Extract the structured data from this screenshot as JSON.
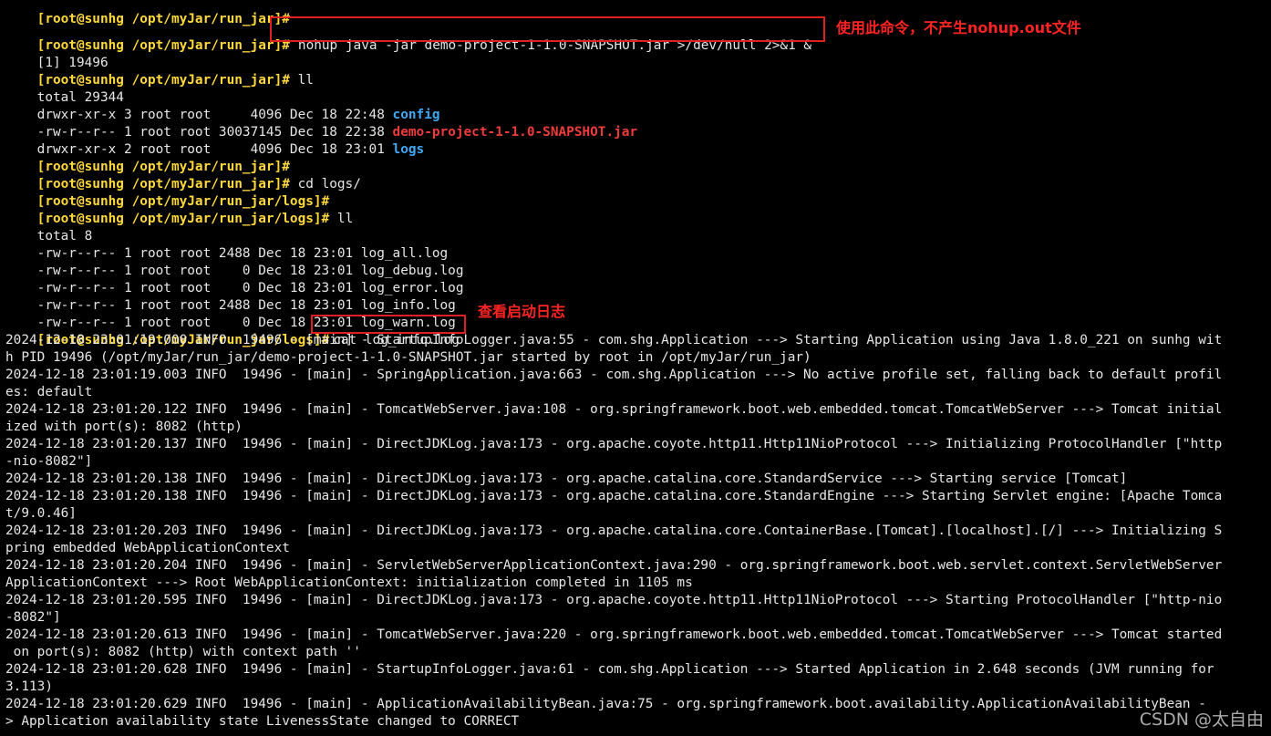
{
  "colors": {
    "background": "#000000",
    "prompt": "#ffd93b",
    "text": "#e6e6e6",
    "directory": "#3fa9f5",
    "jar_file": "#ef3b3b",
    "annotation": "#ff2424"
  },
  "terminal": {
    "prompt_base": "[root@sunhg /opt/myJar/run_jar]#",
    "prompt_logs": "[root@sunhg /opt/myJar/run_jar/logs]#",
    "cmd_nohup": "nohup java -jar demo-project-1-1.0-SNAPSHOT.jar >/dev/null 2>&1 &",
    "job": "[1] 19496",
    "cmd_ll": "ll",
    "total_1": "total 29344",
    "ls1": [
      {
        "perm": "drwxr-xr-x 3 root root     4096 Dec 18 22:48 ",
        "name": "config"
      },
      {
        "perm": "-rw-r--r-- 1 root root 30037145 Dec 18 22:38 ",
        "name": "demo-project-1-1.0-SNAPSHOT.jar"
      },
      {
        "perm": "drwxr-xr-x 2 root root     4096 Dec 18 23:01 ",
        "name": "logs"
      }
    ],
    "cmd_cd": "cd logs/",
    "total_2": "total 8",
    "ls2": [
      "-rw-r--r-- 1 root root 2488 Dec 18 23:01 log_all.log",
      "-rw-r--r-- 1 root root    0 Dec 18 23:01 log_debug.log",
      "-rw-r--r-- 1 root root    0 Dec 18 23:01 log_error.log",
      "-rw-r--r-- 1 root root 2488 Dec 18 23:01 log_info.log",
      "-rw-r--r-- 1 root root    0 Dec 18 23:01 log_warn.log"
    ],
    "cmd_cat": "cat log_info.log",
    "log": [
      "2024-12-18 23:01:19.000 INFO  19496 - [main] - StartupInfoLogger.java:55 - com.shg.Application ---> Starting Application using Java 1.8.0_221 on sunhg wit",
      "h PID 19496 (/opt/myJar/run_jar/demo-project-1-1.0-SNAPSHOT.jar started by root in /opt/myJar/run_jar)",
      "2024-12-18 23:01:19.003 INFO  19496 - [main] - SpringApplication.java:663 - com.shg.Application ---> No active profile set, falling back to default profil",
      "es: default",
      "2024-12-18 23:01:20.122 INFO  19496 - [main] - TomcatWebServer.java:108 - org.springframework.boot.web.embedded.tomcat.TomcatWebServer ---> Tomcat initial",
      "ized with port(s): 8082 (http)",
      "2024-12-18 23:01:20.137 INFO  19496 - [main] - DirectJDKLog.java:173 - org.apache.coyote.http11.Http11NioProtocol ---> Initializing ProtocolHandler [\"http",
      "-nio-8082\"]",
      "2024-12-18 23:01:20.138 INFO  19496 - [main] - DirectJDKLog.java:173 - org.apache.catalina.core.StandardService ---> Starting service [Tomcat]",
      "2024-12-18 23:01:20.138 INFO  19496 - [main] - DirectJDKLog.java:173 - org.apache.catalina.core.StandardEngine ---> Starting Servlet engine: [Apache Tomca",
      "t/9.0.46]",
      "2024-12-18 23:01:20.203 INFO  19496 - [main] - DirectJDKLog.java:173 - org.apache.catalina.core.ContainerBase.[Tomcat].[localhost].[/] ---> Initializing S",
      "pring embedded WebApplicationContext",
      "2024-12-18 23:01:20.204 INFO  19496 - [main] - ServletWebServerApplicationContext.java:290 - org.springframework.boot.web.servlet.context.ServletWebServer",
      "ApplicationContext ---> Root WebApplicationContext: initialization completed in 1105 ms",
      "2024-12-18 23:01:20.595 INFO  19496 - [main] - DirectJDKLog.java:173 - org.apache.coyote.http11.Http11NioProtocol ---> Starting ProtocolHandler [\"http-nio",
      "-8082\"]",
      "2024-12-18 23:01:20.613 INFO  19496 - [main] - TomcatWebServer.java:220 - org.springframework.boot.web.embedded.tomcat.TomcatWebServer ---> Tomcat started",
      " on port(s): 8082 (http) with context path ''",
      "2024-12-18 23:01:20.628 INFO  19496 - [main] - StartupInfoLogger.java:61 - com.shg.Application ---> Started Application in 2.648 seconds (JVM running for",
      "3.113)",
      "2024-12-18 23:01:20.629 INFO  19496 - [main] - ApplicationAvailabilityBean.java:75 - org.springframework.boot.availability.ApplicationAvailabilityBean -",
      "> Application availability state LivenessState changed to CORRECT"
    ]
  },
  "annotations": {
    "nohup_note": "使用此命令，不产生nohup.out文件",
    "cat_note": "查看启动日志"
  },
  "watermark": "CSDN @太自由"
}
